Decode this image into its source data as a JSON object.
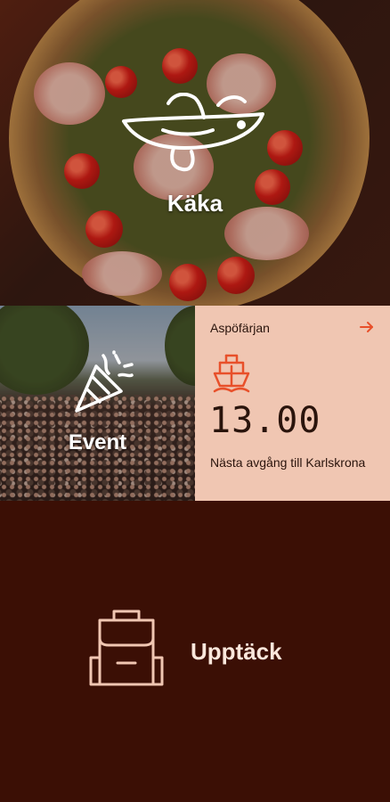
{
  "tiles": {
    "food": {
      "label": "Käka",
      "icon": "fish-icon"
    },
    "event": {
      "label": "Event",
      "icon": "party-popper-icon"
    },
    "ferry": {
      "title": "Aspöfärjan",
      "time": "13.00",
      "description": "Nästa avgång till Karlskrona",
      "icon": "ferry-icon",
      "arrow_icon": "arrow-right-icon"
    },
    "discover": {
      "label": "Upptäck",
      "icon": "backpack-icon"
    }
  },
  "colors": {
    "background": "#3b0f05",
    "ferry_tile": "#f0c6b2",
    "accent": "#e8502a",
    "text_light": "#fbe7dc"
  }
}
